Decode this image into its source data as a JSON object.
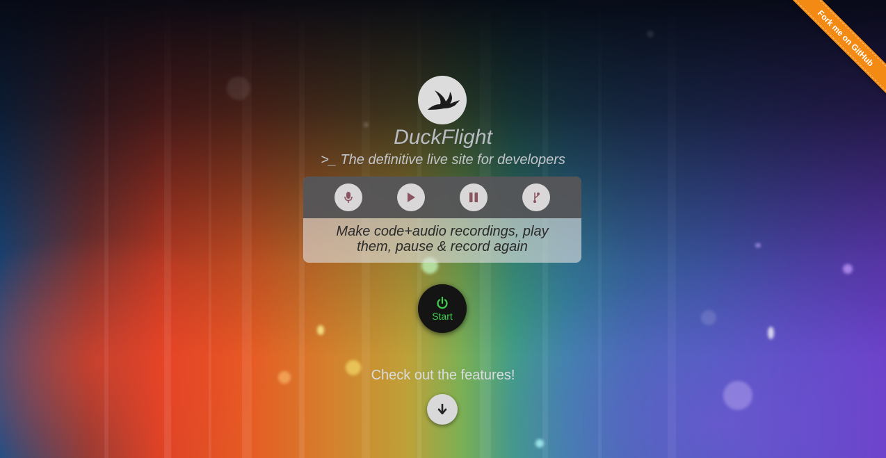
{
  "app": {
    "name": "DuckFlight",
    "tagline": ">_ The definitive live site for developers"
  },
  "ribbon": {
    "label": "Fork me on GitHub",
    "color": "#f28a13"
  },
  "features": {
    "buttons": [
      {
        "icon": "microphone-icon"
      },
      {
        "icon": "play-icon"
      },
      {
        "icon": "pause-icon"
      },
      {
        "icon": "branch-icon"
      }
    ],
    "description": "Make code+audio recordings, play them, pause & record again"
  },
  "start": {
    "label": "Start",
    "icon": "power-icon",
    "accent": "#3ed14f"
  },
  "cta": {
    "text": "Check out the features!",
    "icon": "arrow-down-icon"
  }
}
